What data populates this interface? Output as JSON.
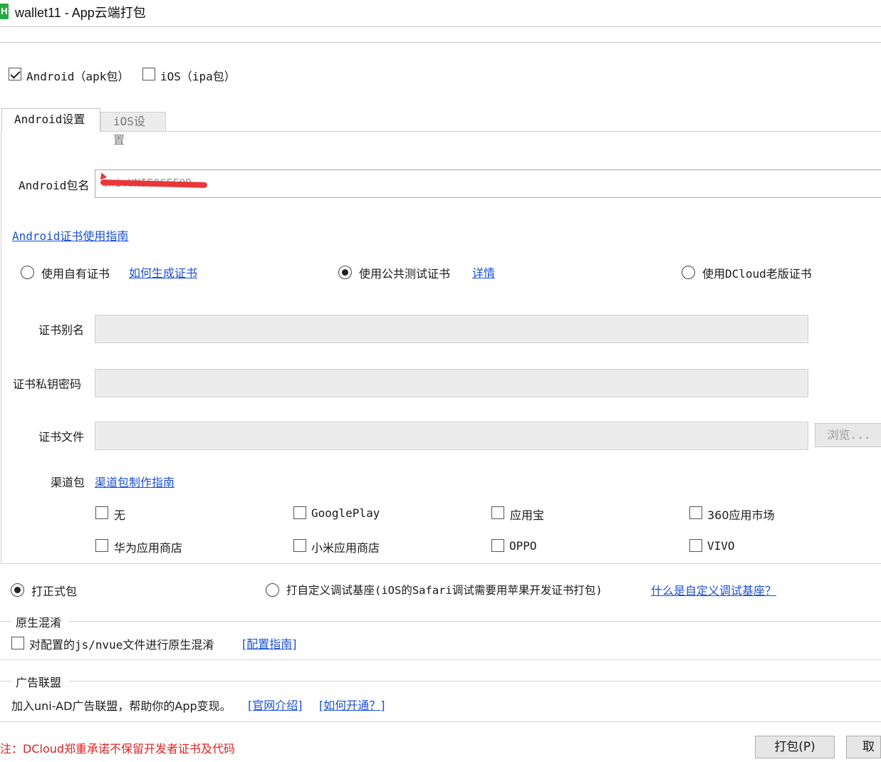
{
  "window": {
    "icon_text": "H",
    "title": "wallet11 - App云端打包"
  },
  "platforms": {
    "android": {
      "label": "Android（apk包）",
      "checked": true
    },
    "ios": {
      "label": "iOS（ipa包）",
      "checked": false
    }
  },
  "tabs": [
    {
      "label": "Android设置",
      "active": true
    },
    {
      "label": "iOS设置",
      "active": false
    }
  ],
  "android": {
    "package_label": "Android包名",
    "package_value": "uni.UNIE0CFF0D",
    "cert_guide_link": "Android证书使用指南",
    "cert_options": [
      {
        "label": "使用自有证书",
        "link": "如何生成证书",
        "selected": false
      },
      {
        "label": "使用公共测试证书",
        "link": "详情",
        "selected": true
      },
      {
        "label": "使用DCloud老版证书",
        "selected": false
      }
    ],
    "alias_label": "证书别名",
    "password_label": "证书私钥密码",
    "file_label": "证书文件",
    "browse_label": "浏览...",
    "channel_label": "渠道包",
    "channel_guide_link": "渠道包制作指南",
    "channels": [
      {
        "label": "无",
        "checked": false
      },
      {
        "label": "GooglePlay",
        "checked": false
      },
      {
        "label": "应用宝",
        "checked": false
      },
      {
        "label": "360应用市场",
        "checked": false
      },
      {
        "label": "华为应用商店",
        "checked": false
      },
      {
        "label": "小米应用商店",
        "checked": false
      },
      {
        "label": "OPPO",
        "checked": false
      },
      {
        "label": "VIVO",
        "checked": false
      }
    ]
  },
  "build_type": {
    "formal": {
      "label": "打正式包",
      "selected": true
    },
    "custom_base": {
      "label": "打自定义调试基座(iOS的Safari调试需要用苹果开发证书打包)",
      "selected": false
    },
    "custom_base_link": "什么是自定义调试基座？"
  },
  "obfuscation": {
    "legend": "原生混淆",
    "checkbox_label": "对配置的js/nvue文件进行原生混淆",
    "checked": false,
    "guide_link": "[配置指南]"
  },
  "ad": {
    "legend": "广告联盟",
    "text": "加入uni-AD广告联盟，帮助你的App变现。",
    "link_intro": "[官网介绍]",
    "link_howto": "[如何开通？]"
  },
  "footer": {
    "notice": "注：DCloud郑重承诺不保留开发者证书及代码",
    "notice_color": "#e02020",
    "pack_button": "打包(P)",
    "cancel_button": "取消"
  }
}
